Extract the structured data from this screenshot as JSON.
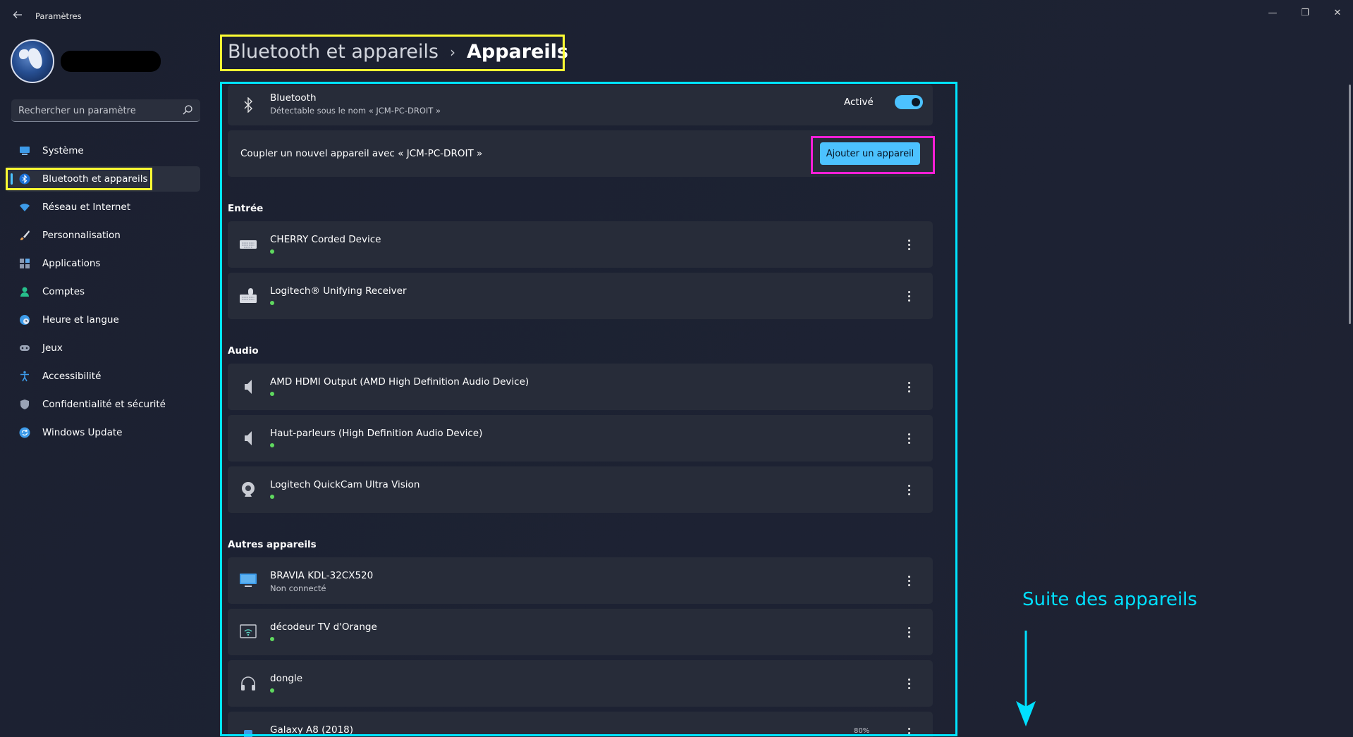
{
  "window": {
    "title": "Paramètres",
    "back_icon": "arrow-left-icon",
    "minimize_glyph": "—",
    "maximize_glyph": "❐",
    "close_glyph": "✕"
  },
  "sidebar": {
    "search": {
      "placeholder": "Rechercher un paramètre"
    },
    "items": [
      {
        "label": "Système",
        "icon": "monitor-icon",
        "color": "#3d9be9"
      },
      {
        "label": "Bluetooth et appareils",
        "icon": "bluetooth-icon",
        "color": "#1a6fd6",
        "active": true
      },
      {
        "label": "Réseau et Internet",
        "icon": "wifi-icon",
        "color": "#3d9be9"
      },
      {
        "label": "Personnalisation",
        "icon": "brush-icon",
        "color": "#e8a35a"
      },
      {
        "label": "Applications",
        "icon": "apps-icon",
        "color": "#8e9ab0"
      },
      {
        "label": "Comptes",
        "icon": "person-icon",
        "color": "#27c08c"
      },
      {
        "label": "Heure et langue",
        "icon": "globe-clock-icon",
        "color": "#3d9be9"
      },
      {
        "label": "Jeux",
        "icon": "gamepad-icon",
        "color": "#9aa3b5"
      },
      {
        "label": "Accessibilité",
        "icon": "accessibility-icon",
        "color": "#3d9be9"
      },
      {
        "label": "Confidentialité et sécurité",
        "icon": "shield-icon",
        "color": "#9aa3b5"
      },
      {
        "label": "Windows Update",
        "icon": "update-icon",
        "color": "#3d9be9"
      }
    ]
  },
  "header": {
    "parent": "Bluetooth et appareils",
    "separator": "›",
    "current": "Appareils"
  },
  "bluetooth": {
    "title": "Bluetooth",
    "subtitle": "Détectable sous le nom « JCM-PC-DROIT »",
    "state_label": "Activé",
    "enabled": true
  },
  "pair": {
    "text": "Coupler un nouvel appareil avec « JCM-PC-DROIT »",
    "button_label": "Ajouter un appareil"
  },
  "sections": {
    "input": "Entrée",
    "audio": "Audio",
    "other": "Autres appareils"
  },
  "devices": {
    "input": [
      {
        "name": "CHERRY Corded Device",
        "icon": "keyboard-icon",
        "connected": true
      },
      {
        "name": "Logitech® Unifying Receiver",
        "icon": "keyboard-mouse-icon",
        "connected": true
      }
    ],
    "audio": [
      {
        "name": "AMD HDMI Output (AMD High Definition Audio Device)",
        "icon": "speaker-icon",
        "connected": true
      },
      {
        "name": "Haut-parleurs (High Definition Audio Device)",
        "icon": "speaker-icon",
        "connected": true
      },
      {
        "name": "Logitech QuickCam Ultra Vision",
        "icon": "webcam-icon",
        "connected": true
      }
    ],
    "other": [
      {
        "name": "BRAVIA KDL-32CX520",
        "status": "Non connecté",
        "icon": "tv-icon"
      },
      {
        "name": "décodeur TV d'Orange",
        "icon": "wireless-display-icon",
        "connected": true
      },
      {
        "name": "dongle",
        "icon": "headphones-icon",
        "connected": true
      },
      {
        "name": "Galaxy A8 (2018)",
        "icon": "phone-icon",
        "battery": "80%"
      }
    ]
  },
  "annotation": {
    "text": "Suite des appareils",
    "color": "#00e0ff"
  },
  "colors": {
    "accent": "#4cc2ff",
    "highlight_yellow": "#ffff33",
    "highlight_magenta": "#ff1fd6",
    "highlight_cyan": "#00e5ff",
    "status_green": "#5fd85f"
  }
}
